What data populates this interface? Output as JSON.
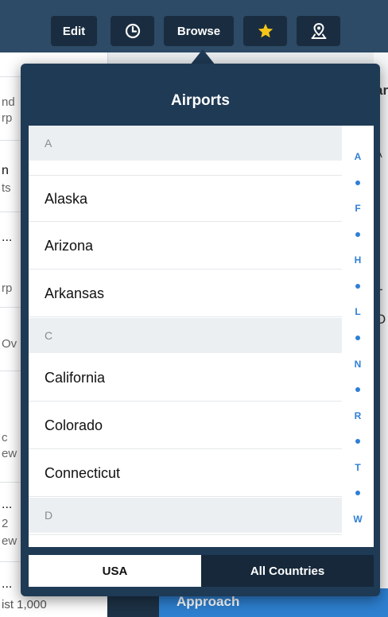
{
  "toolbar": {
    "edit_label": "Edit",
    "browse_label": "Browse",
    "icons": [
      "clock-icon",
      "star-icon",
      "map-pin-icon"
    ],
    "accent_star": "#f5c518"
  },
  "popover": {
    "title": "Airports",
    "sections": [
      {
        "header": "A",
        "items": [
          "Alaska",
          "Arizona",
          "Arkansas"
        ]
      },
      {
        "header": "C",
        "items": [
          "California",
          "Colorado",
          "Connecticut"
        ]
      },
      {
        "header": "D",
        "items": []
      }
    ],
    "index": [
      "A",
      "F",
      "H",
      "L",
      "N",
      "R",
      "T",
      "W"
    ],
    "segment": {
      "usa": "USA",
      "all_countries": "All Countries",
      "selected": "USA"
    }
  },
  "background": {
    "left_fragments": [
      "nd",
      "rp",
      "n",
      "ts",
      "...",
      "rp",
      "Ov",
      "c",
      "ew",
      "...",
      "2",
      "ew",
      "...",
      "ist 1,000"
    ],
    "right_fragments": [
      "ar",
      "r",
      "A",
      "L",
      "O"
    ],
    "approach_label": "Approach"
  },
  "colors": {
    "toolbar": "#2d4a66",
    "popover": "#1f3a55",
    "index_blue": "#2f7fd6"
  }
}
